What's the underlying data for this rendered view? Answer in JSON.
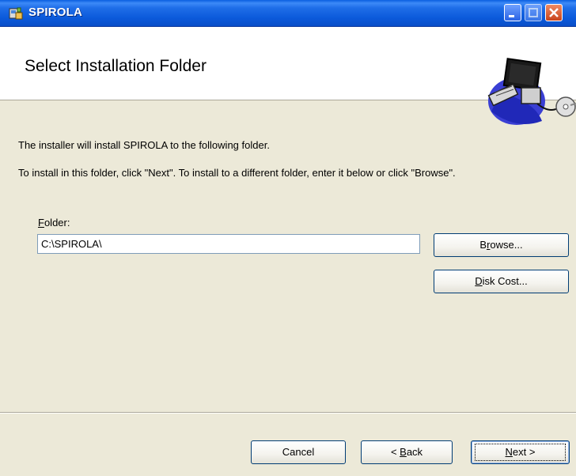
{
  "window": {
    "title": "SPIROLA",
    "app_icon": "installer-icon",
    "controls": [
      "minimize-icon",
      "maximize-icon",
      "close-icon"
    ]
  },
  "header": {
    "title": "Select Installation Folder",
    "art": "computer-cd-icon"
  },
  "content": {
    "line1": "The installer will install SPIROLA to the following folder.",
    "line2": "To install in this folder, click \"Next\". To install to a different folder, enter it below or click \"Browse\".",
    "folder_label_key": "F",
    "folder_label_rest": "older:",
    "folder_value": "C:\\SPIROLA\\"
  },
  "buttons": {
    "browse_key": "r",
    "browse_pre": "B",
    "browse_post": "owse...",
    "diskcost_key": "D",
    "diskcost_rest": "isk Cost...",
    "cancel": "Cancel",
    "back_pre": "< ",
    "back_key": "B",
    "back_post": "ack",
    "next_key": "N",
    "next_post": "ext >"
  },
  "colors": {
    "titlebar": "#0a5fe0",
    "face": "#ece9d8",
    "button_border": "#003c74"
  }
}
